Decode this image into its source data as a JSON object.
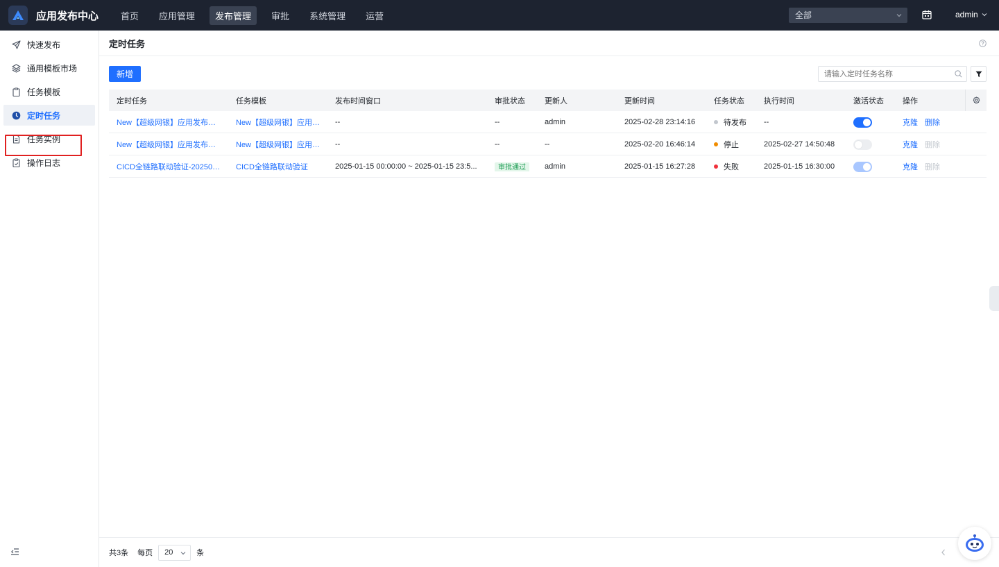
{
  "app": {
    "title": "应用发布中心"
  },
  "topnav": [
    "首页",
    "应用管理",
    "发布管理",
    "审批",
    "系统管理",
    "运营"
  ],
  "topnav_active": "发布管理",
  "env_select": {
    "value": "全部"
  },
  "user": {
    "name": "admin"
  },
  "sidebar": {
    "items": [
      {
        "label": "快速发布",
        "icon": "paper-plane-icon"
      },
      {
        "label": "通用模板市场",
        "icon": "layers-icon"
      },
      {
        "label": "任务模板",
        "icon": "clipboard-icon"
      },
      {
        "label": "定时任务",
        "icon": "clock-icon",
        "active": true
      },
      {
        "label": "任务实例",
        "icon": "document-icon"
      },
      {
        "label": "操作日志",
        "icon": "log-icon"
      }
    ]
  },
  "page": {
    "title": "定时任务",
    "add_button": "新增",
    "search_placeholder": "请输入定时任务名称"
  },
  "table": {
    "headers": [
      "定时任务",
      "任务模板",
      "发布时间窗口",
      "审批状态",
      "更新人",
      "更新时间",
      "任务状态",
      "执行时间",
      "激活状态",
      "操作"
    ],
    "rows": [
      {
        "task": "New【超级网银】应用发布模板...",
        "template": "New【超级网银】应用发...",
        "window": "--",
        "approval": "--",
        "updater": "admin",
        "updated_at": "2025-02-28 23:14:16",
        "status": "待发布",
        "status_color": "#c2c7ce",
        "exec_time": "--",
        "active": "on",
        "action1": "克隆",
        "action2": "删除"
      },
      {
        "task": "New【超级网银】应用发布模板...",
        "template": "New【超级网银】应用发...",
        "window": "--",
        "approval": "--",
        "updater": "--",
        "updated_at": "2025-02-20 16:46:14",
        "status": "停止",
        "status_color": "#f08c00",
        "exec_time": "2025-02-27 14:50:48",
        "active": "off",
        "action1": "克隆",
        "action2": "删除"
      },
      {
        "task": "CICD全链路联动验证-2025011...",
        "template": "CICD全链路联动验证",
        "window": "2025-01-15 00:00:00 ~ 2025-01-15 23:5...",
        "approval": "审批通过",
        "updater": "admin",
        "updated_at": "2025-01-15 16:27:28",
        "status": "失败",
        "status_color": "#f0303a",
        "exec_time": "2025-01-15 16:30:00",
        "active": "on-disabled",
        "action1": "克隆",
        "action2": "删除"
      }
    ]
  },
  "footer": {
    "total": "共3条",
    "per_page_label": "每页",
    "per_page_value": "20",
    "unit": "条"
  },
  "colors": {
    "primary": "#1f6fff",
    "topbar": "#1d2330",
    "highlight": "#e02020"
  }
}
